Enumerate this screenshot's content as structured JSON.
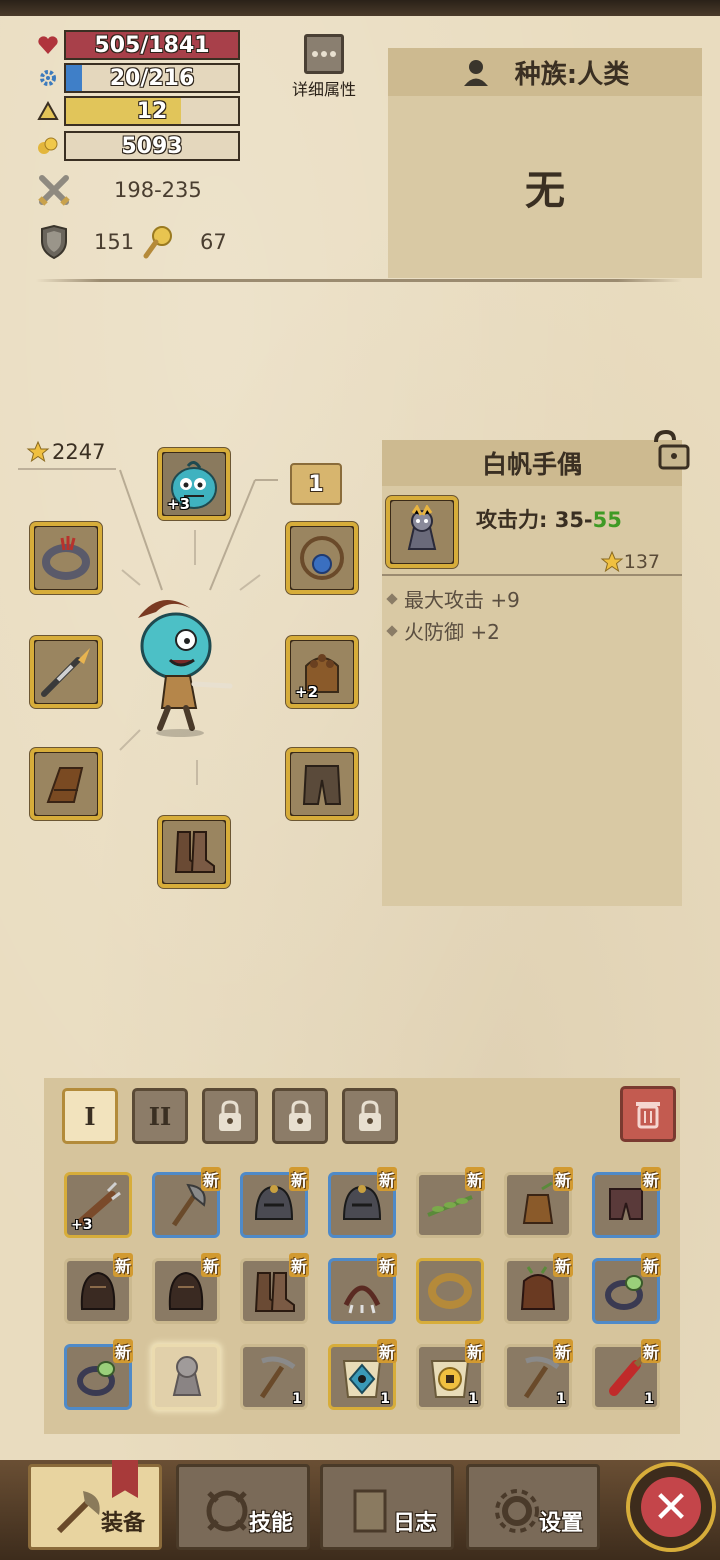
{
  "stats": {
    "hp": {
      "text": "505/1841",
      "fraction": 0.274,
      "color": "#a8404a"
    },
    "mp": {
      "text": "20/216",
      "fraction": 0.093,
      "color": "#3f7fc8"
    },
    "level": {
      "text": "12",
      "fraction": 0.67,
      "color": "#e1c55a"
    },
    "gold": {
      "text": "5093"
    },
    "attack": "198-235",
    "defense": "151",
    "luck": "67",
    "detail_label": "详细属性"
  },
  "race": {
    "title": "种族:人类",
    "value": "无"
  },
  "equipment": {
    "score": "2247",
    "slot_tag": "1",
    "slots": [
      {
        "name": "pet",
        "plus": "+3",
        "icon": "blue-pet-icon"
      },
      {
        "name": "ring",
        "plus": "",
        "icon": "spiked-ring-icon"
      },
      {
        "name": "amulet",
        "plus": "",
        "icon": "rope-amulet-icon"
      },
      {
        "name": "weapon",
        "plus": "",
        "icon": "spear-icon"
      },
      {
        "name": "gloves",
        "plus": "+2",
        "icon": "studded-glove-icon"
      },
      {
        "name": "bracer",
        "plus": "",
        "icon": "leather-bracer-icon"
      },
      {
        "name": "pants",
        "plus": "",
        "icon": "pants-icon"
      },
      {
        "name": "boots",
        "plus": "",
        "icon": "boots-icon"
      }
    ]
  },
  "item": {
    "name": "白帆手偶",
    "attack_label": "攻击力: 35-",
    "attack_high": "55",
    "score": "137",
    "attrs": [
      "最大攻击 +9",
      "火防御 +2"
    ]
  },
  "inventory": {
    "tabs": [
      {
        "label": "I",
        "state": "active"
      },
      {
        "label": "II",
        "state": "normal"
      },
      {
        "label": "",
        "state": "locked"
      },
      {
        "label": "",
        "state": "locked"
      },
      {
        "label": "",
        "state": "locked"
      }
    ],
    "new_label": "新",
    "items": [
      {
        "icon": "spiked-club-icon",
        "border": "gold",
        "new": false,
        "plus": "+3",
        "count": ""
      },
      {
        "icon": "axe-icon",
        "border": "blue",
        "new": true,
        "plus": "",
        "count": ""
      },
      {
        "icon": "helmet-icon",
        "border": "blue",
        "new": true,
        "plus": "",
        "count": ""
      },
      {
        "icon": "helmet-icon",
        "border": "blue",
        "new": true,
        "plus": "",
        "count": ""
      },
      {
        "icon": "vine-icon",
        "border": "plain",
        "new": true,
        "plus": "",
        "count": ""
      },
      {
        "icon": "bag-icon",
        "border": "plain",
        "new": true,
        "plus": "",
        "count": ""
      },
      {
        "icon": "shorts-icon",
        "border": "blue",
        "new": true,
        "plus": "",
        "count": ""
      },
      {
        "icon": "hood-icon",
        "border": "plain",
        "new": true,
        "plus": "",
        "count": ""
      },
      {
        "icon": "hood-icon",
        "border": "plain",
        "new": true,
        "plus": "",
        "count": ""
      },
      {
        "icon": "boots-icon",
        "border": "plain",
        "new": true,
        "plus": "",
        "count": ""
      },
      {
        "icon": "claw-icon",
        "border": "blue",
        "new": true,
        "plus": "",
        "count": ""
      },
      {
        "icon": "wood-ring-icon",
        "border": "gold",
        "new": false,
        "plus": "",
        "count": ""
      },
      {
        "icon": "root-glove-icon",
        "border": "plain",
        "new": true,
        "plus": "",
        "count": ""
      },
      {
        "icon": "gem-ring-icon",
        "border": "blue",
        "new": true,
        "plus": "",
        "count": ""
      },
      {
        "icon": "gem-ring-icon",
        "border": "blue",
        "new": true,
        "plus": "",
        "count": ""
      },
      {
        "icon": "puppet-icon",
        "border": "selected",
        "new": false,
        "plus": "",
        "count": ""
      },
      {
        "icon": "pickaxe-icon",
        "border": "plain",
        "new": false,
        "plus": "",
        "count": "1"
      },
      {
        "icon": "eye-scroll-icon",
        "border": "gold",
        "new": true,
        "plus": "",
        "count": "1"
      },
      {
        "icon": "coin-scroll-icon",
        "border": "plain",
        "new": true,
        "plus": "",
        "count": "1"
      },
      {
        "icon": "pickaxe-icon",
        "border": "plain",
        "new": true,
        "plus": "",
        "count": "1"
      },
      {
        "icon": "potion-icon",
        "border": "plain",
        "new": true,
        "plus": "",
        "count": "1"
      }
    ]
  },
  "nav": {
    "equip": "装备",
    "skill": "技能",
    "log": "日志",
    "settings": "设置"
  }
}
